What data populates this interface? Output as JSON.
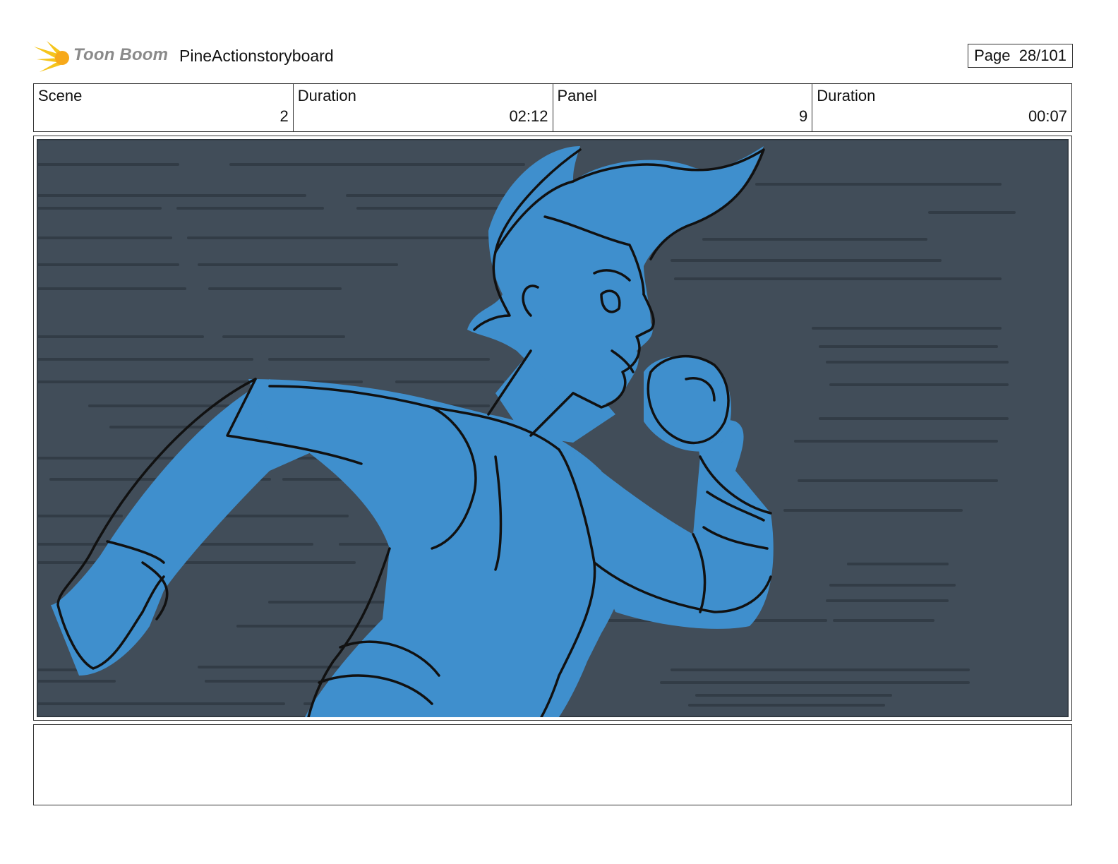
{
  "header": {
    "logo_text": "Toon Boom",
    "document_title": "PineActionstoryboard",
    "page_label": "Page",
    "page_number": "28/101"
  },
  "info": {
    "scene_label": "Scene",
    "scene_value": "2",
    "scene_duration_label": "Duration",
    "scene_duration_value": "02:12",
    "panel_label": "Panel",
    "panel_value": "9",
    "panel_duration_label": "Duration",
    "panel_duration_value": "00:07"
  },
  "panel": {
    "background_color": "#414d59",
    "figure_color": "#3f8fcd",
    "line_color": "#111111",
    "speed_line_color": "#323c46"
  },
  "notes": {
    "text": ""
  }
}
